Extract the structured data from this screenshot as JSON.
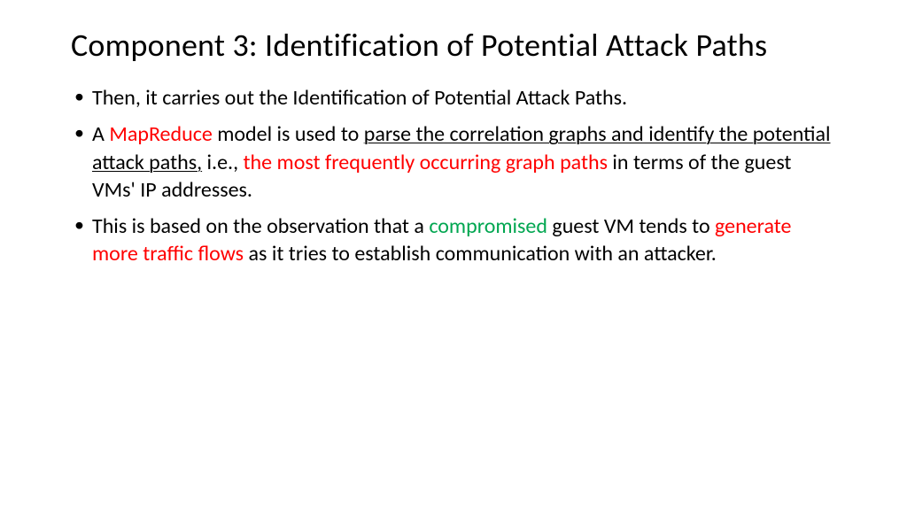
{
  "title": "Component 3: Identification of Potential Attack Paths",
  "bullets": {
    "b0": {
      "t0": "Then, it carries out the Identification of Potential Attack Paths."
    },
    "b1": {
      "t0": " A ",
      "t1": "MapReduce",
      "t2": " model is used to ",
      "t3": "parse the correlation graphs and identify the potential attack paths,",
      "t4": " i.e., ",
      "t5": "the most frequently occurring graph paths",
      "t6": " in terms of the guest VMs' IP addresses."
    },
    "b2": {
      "t0": "This is based on the observation that a ",
      "t1": "compromised",
      "t2": " guest VM tends to ",
      "t3": "generate more traffic flows",
      "t4": " as it tries to establish communication with an attacker."
    }
  }
}
